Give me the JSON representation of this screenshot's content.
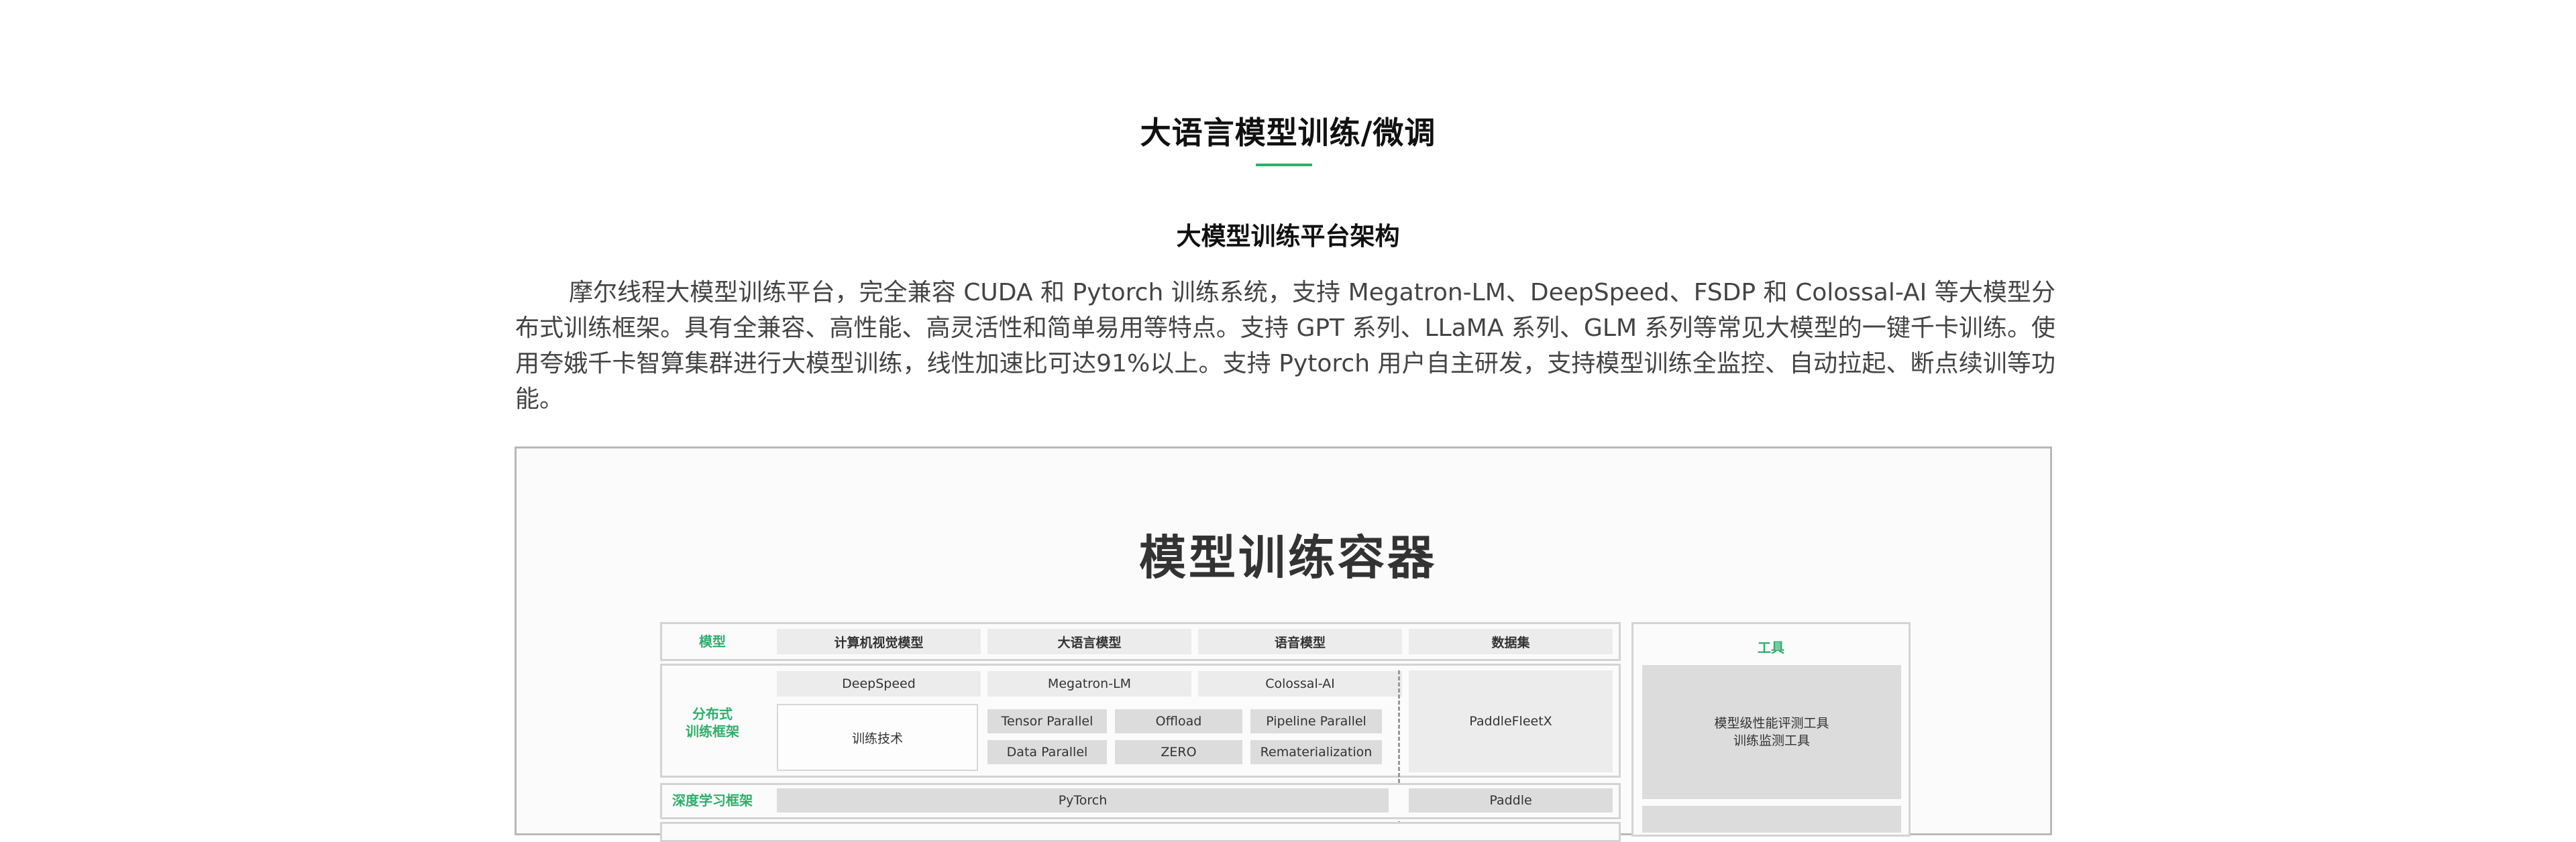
{
  "section": {
    "title": "大语言模型训练/微调",
    "subtitle": "大模型训练平台架构",
    "intro": "摩尔线程大模型训练平台，完全兼容 CUDA 和 Pytorch 训练系统，支持 Megatron-LM、DeepSpeed、FSDP 和 Colossal-AI 等大模型分布式训练框架。具有全兼容、高性能、高灵活性和简单易用等特点。支持 GPT 系列、LLaMA 系列、GLM 系列等常见大模型的一键千卡训练。使用夸娥千卡智算集群进行大模型训练，线性加速比可达91%以上。支持 Pytorch 用户自主研发，支持模型训练全监控、自动拉起、断点续训等功能。"
  },
  "accent_color": "#2fae6a",
  "diagram": {
    "title": "模型训练容器",
    "model_row": {
      "label": "模型",
      "items": [
        "计算机视觉模型",
        "大语言模型",
        "语音模型",
        "数据集"
      ]
    },
    "distributed_row": {
      "label": "分布式\n训练框架",
      "frameworks": [
        "DeepSpeed",
        "Megatron-LM",
        "Colossal-AI"
      ],
      "training_tech_label": "训练技术",
      "techniques": [
        "Tensor Parallel",
        "Offload",
        "Pipeline Parallel",
        "Data Parallel",
        "ZERO",
        "Rematerialization"
      ],
      "paddle_fleet": "PaddleFleetX"
    },
    "dl_row": {
      "label": "深度学习框架",
      "pytorch": "PyTorch",
      "paddle": "Paddle"
    },
    "tools": {
      "label": "工具",
      "item": "模型级性能评测工具\n训练监测工具"
    }
  }
}
